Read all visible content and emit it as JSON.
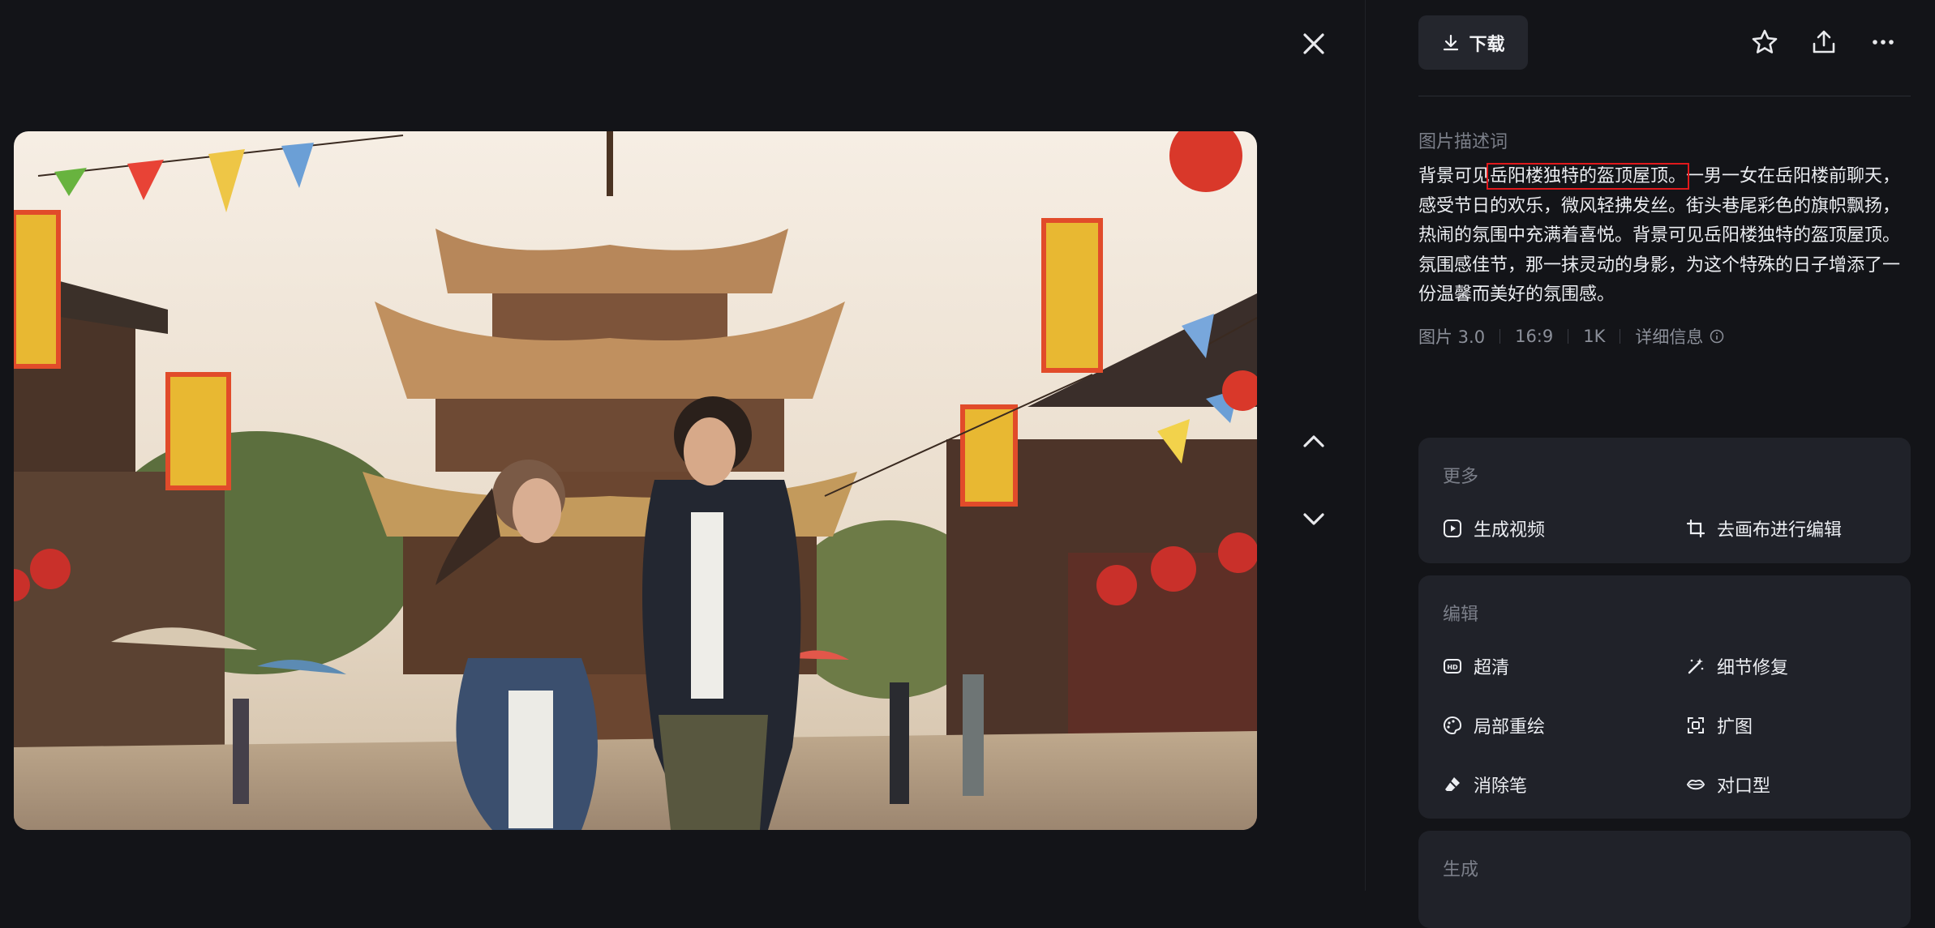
{
  "toolbar": {
    "download_label": "下载"
  },
  "description": {
    "heading": "图片描述词",
    "before": "背景可见",
    "highlight": "岳阳楼独特的盔顶屋顶。",
    "after": "一男一女在岳阳楼前聊天，感受节日的欢乐，微风轻拂发丝。街头巷尾彩色的旗帜飘扬，热闹的氛围中充满着喜悦。背景可见岳阳楼独特的盔顶屋顶。氛围感佳节，那一抹灵动的身影，为这个特殊的日子增添了一份温馨而美好的氛围感。"
  },
  "meta": {
    "model": "图片 3.0",
    "ratio": "16:9",
    "resolution": "1K",
    "detail_label": "详细信息"
  },
  "more": {
    "heading": "更多",
    "actions": [
      {
        "label": "生成视频",
        "icon": "play-icon"
      },
      {
        "label": "去画布进行编辑",
        "icon": "crop-icon"
      }
    ]
  },
  "edit": {
    "heading": "编辑",
    "actions": [
      {
        "label": "超清",
        "icon": "hd-icon"
      },
      {
        "label": "细节修复",
        "icon": "magic-wand-icon"
      },
      {
        "label": "局部重绘",
        "icon": "palette-icon"
      },
      {
        "label": "扩图",
        "icon": "expand-icon"
      },
      {
        "label": "消除笔",
        "icon": "eraser-icon"
      },
      {
        "label": "对口型",
        "icon": "lips-icon"
      }
    ]
  },
  "generate": {
    "heading": "生成"
  },
  "colors": {
    "background": "#131418",
    "card": "#202229",
    "highlight_box": "#e0191c",
    "text": "#eceef2",
    "muted": "#7b7f89"
  }
}
